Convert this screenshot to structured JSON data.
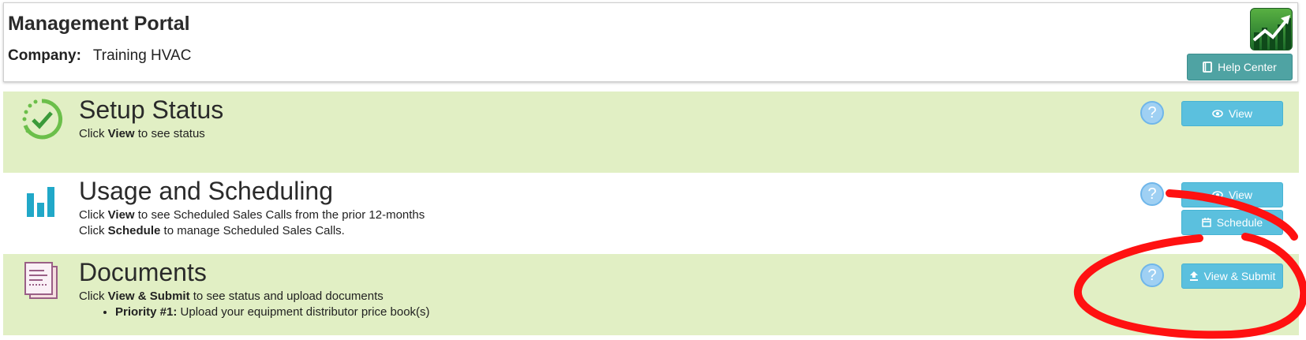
{
  "header": {
    "title": "Management Portal",
    "company_label": "Company:",
    "company_name": "Training HVAC",
    "help_label": "Help Center",
    "logo_icon": "trend-up-chart-icon"
  },
  "sections": {
    "setup": {
      "title": "Setup Status",
      "icon": "check-progress-icon",
      "desc_pre": "Click ",
      "desc_bold": "View",
      "desc_post": " to see status",
      "help_symbol": "?",
      "button_label": "View"
    },
    "usage": {
      "title": "Usage and Scheduling",
      "icon": "bar-chart-icon",
      "line1_pre": "Click ",
      "line1_bold": "View",
      "line1_post": " to see Scheduled Sales Calls from the prior 12-months",
      "line2_pre": "Click ",
      "line2_bold": "Schedule",
      "line2_post": " to manage Scheduled Sales Calls.",
      "help_symbol": "?",
      "view_label": "View",
      "schedule_label": "Schedule"
    },
    "documents": {
      "title": "Documents",
      "icon": "documents-icon",
      "desc_pre": "Click ",
      "desc_bold": "View & Submit",
      "desc_post": " to see status and upload documents",
      "bullet_bold": "Priority #1:",
      "bullet_text": " Upload your equipment distributor price book(s)",
      "help_symbol": "?",
      "button_label": "View & Submit"
    }
  },
  "colors": {
    "row_green": "#e1efc4",
    "button_blue": "#5bc0de",
    "help_teal": "#4fa3a3",
    "annotation_red": "#ff0000"
  }
}
